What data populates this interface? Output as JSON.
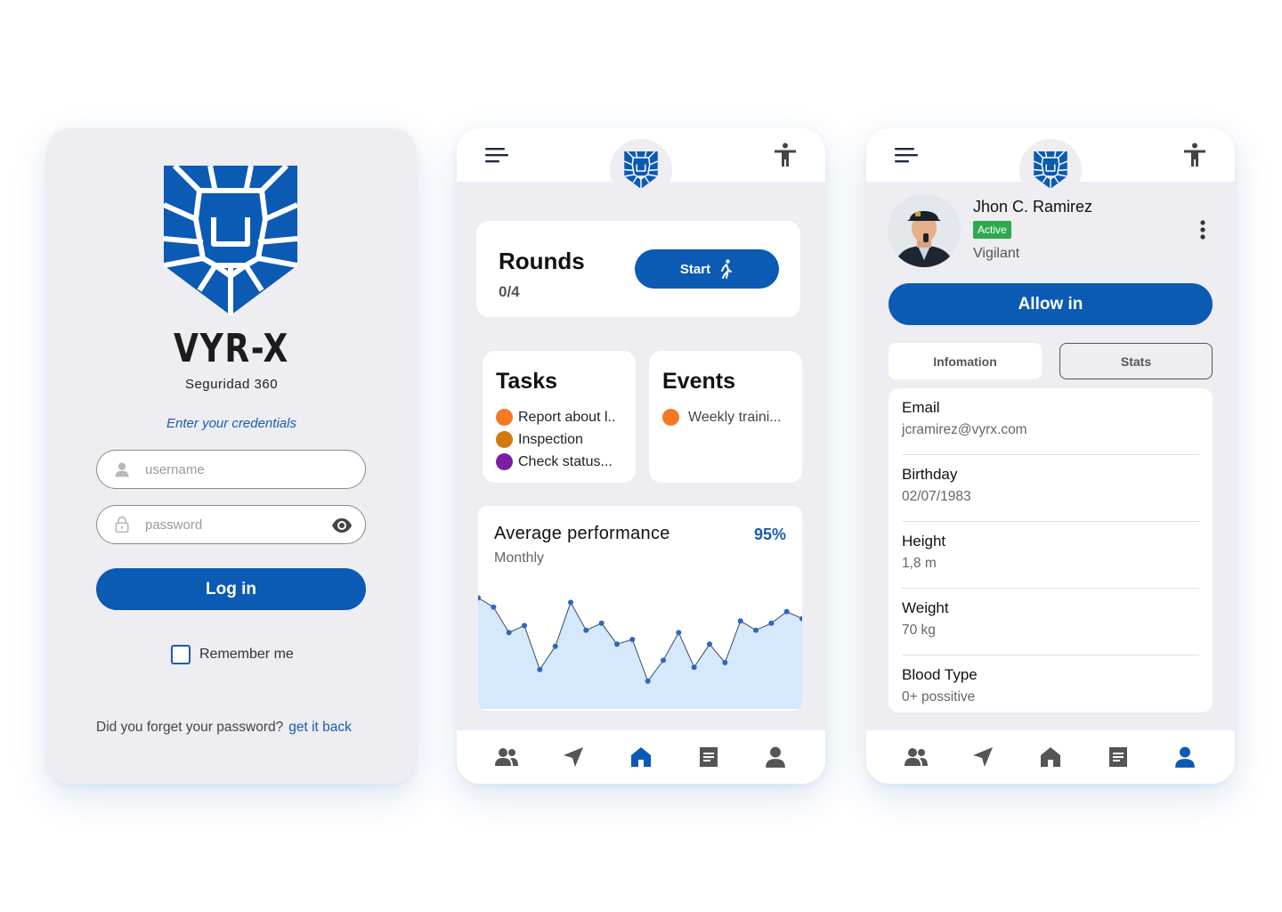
{
  "colors": {
    "primary": "#0b5ab4",
    "card_bg": "#ededf2",
    "active_green": "#2fa84f",
    "chart_fill": "#d6e8fb",
    "chart_line": "#2a66c4"
  },
  "login": {
    "brand": "VYR-X",
    "brand_subtitle": "Seguridad 360",
    "prompt": "Enter your credentials",
    "username_placeholder": "username",
    "password_placeholder": "password",
    "login_label": "Log in",
    "remember_label": "Remember me",
    "forgot_text": "Did you forget your password?",
    "forgot_link": "get it back"
  },
  "dashboard": {
    "rounds": {
      "title": "Rounds",
      "count": "0/4",
      "start_label": "Start"
    },
    "tasks": {
      "title": "Tasks",
      "items": [
        {
          "label": "Report about l..",
          "color": "#f37a21"
        },
        {
          "label": "Inspection",
          "color": "#d4790e"
        },
        {
          "label": "Check status...",
          "color": "#7a1fa2"
        }
      ]
    },
    "events": {
      "title": "Events",
      "items": [
        {
          "label": "Weekly traini...",
          "color": "#f37a21"
        }
      ]
    },
    "performance": {
      "title": "Average performance",
      "subtitle": "Monthly",
      "value": "95%"
    }
  },
  "chart_data": {
    "type": "area",
    "title": "Average performance",
    "subtitle": "Monthly",
    "values": [
      88,
      84,
      73,
      76,
      57,
      67,
      86,
      74,
      77,
      68,
      70,
      52,
      61,
      73,
      58,
      68,
      60,
      78,
      74,
      77,
      82,
      79
    ],
    "ylim": [
      40,
      100
    ],
    "grid": false
  },
  "profile": {
    "name": "Jhon C. Ramirez",
    "status": "Active",
    "role": "Vigilant",
    "allow_label": "Allow in",
    "tabs": [
      "Infomation",
      "Stats"
    ],
    "fields": [
      {
        "label": "Email",
        "value": "jcramirez@vyrx.com"
      },
      {
        "label": "Birthday",
        "value": "02/07/1983"
      },
      {
        "label": "Height",
        "value": "1,8 m"
      },
      {
        "label": "Weight",
        "value": "70 kg"
      },
      {
        "label": "Blood Type",
        "value": "0+ possitive"
      }
    ]
  },
  "nav": {
    "items": [
      "people-icon",
      "navigation-icon",
      "home-icon",
      "document-icon",
      "person-icon"
    ],
    "dashboard_active": "home-icon",
    "profile_active": "person-icon"
  }
}
